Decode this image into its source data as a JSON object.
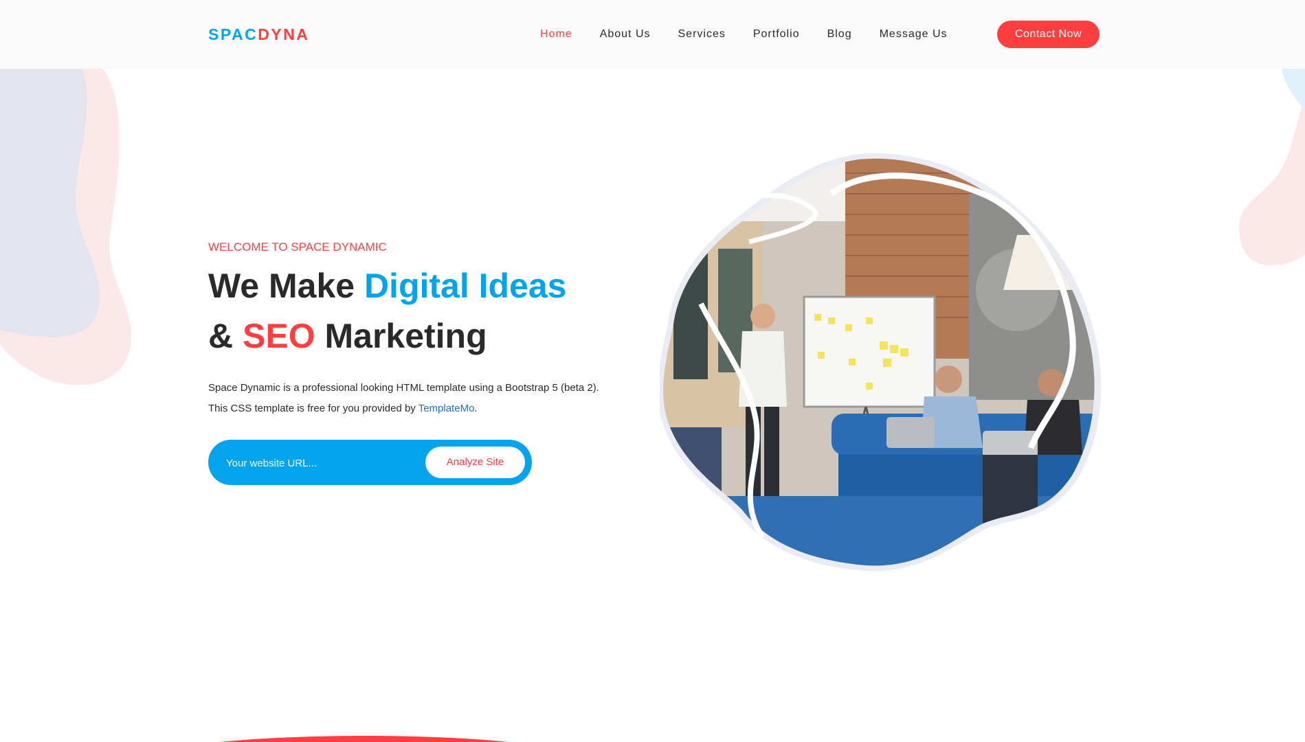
{
  "header": {
    "logo": {
      "part1": "SPAC",
      "part2": "DYNA"
    },
    "nav": [
      {
        "label": "Home",
        "active": true
      },
      {
        "label": "About Us",
        "active": false
      },
      {
        "label": "Services",
        "active": false
      },
      {
        "label": "Portfolio",
        "active": false
      },
      {
        "label": "Blog",
        "active": false
      },
      {
        "label": "Message Us",
        "active": false
      }
    ],
    "contact_button": "Contact Now"
  },
  "hero": {
    "eyebrow": "WELCOME TO SPACE DYNAMIC",
    "headline": {
      "line1_part1": "We Make ",
      "line1_part2": "Digital Ideas",
      "line2_part1": "& ",
      "line2_part2": "SEO",
      "line2_part3": " Marketing"
    },
    "description_part1": "Space Dynamic is a professional looking HTML template using a Bootstrap 5 (beta 2). This CSS template is free for you provided by ",
    "description_link": "TemplateMo",
    "description_part2": ".",
    "search": {
      "placeholder": "Your website URL...",
      "value": "",
      "button": "Analyze Site"
    }
  },
  "colors": {
    "blue": "#03a4ed",
    "red": "#fe3f40",
    "dark": "#2a2a2a",
    "header_bg": "#fafafa"
  }
}
